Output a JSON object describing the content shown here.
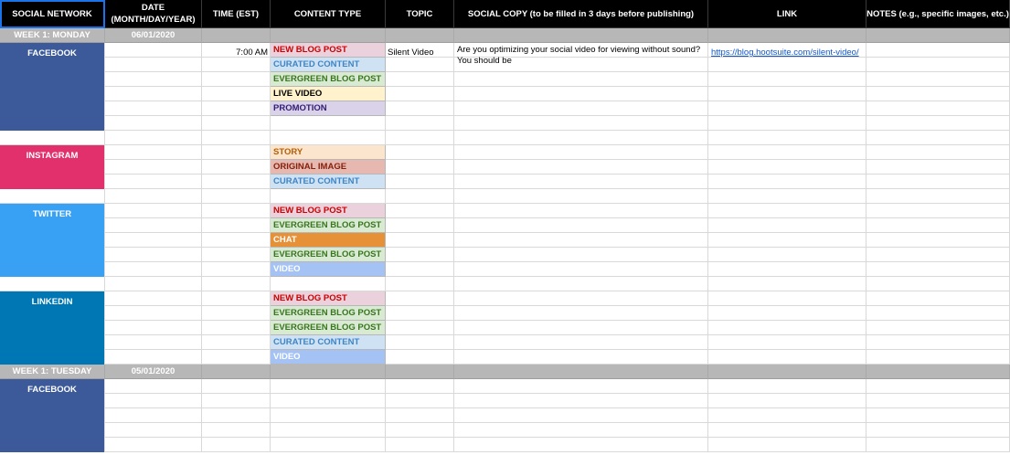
{
  "headers": [
    {
      "line1": "SOCIAL NETWORK",
      "line2": ""
    },
    {
      "line1": "DATE",
      "line2": "(MONTH/DAY/YEAR)"
    },
    {
      "line1": "TIME (EST)",
      "line2": ""
    },
    {
      "line1": "CONTENT TYPE",
      "line2": ""
    },
    {
      "line1": "TOPIC",
      "line2": ""
    },
    {
      "line1": "SOCIAL COPY (to be filled in 3 days before publishing)",
      "line2": ""
    },
    {
      "line1": "LINK",
      "line2": ""
    },
    {
      "line1": "NOTES (e.g., specific images, etc.)",
      "line2": ""
    }
  ],
  "weeks": [
    {
      "label": "WEEK 1: MONDAY",
      "date": "06/01/2020"
    },
    {
      "label": "WEEK 1: TUESDAY",
      "date": "05/01/2020"
    }
  ],
  "networks": [
    {
      "name": "FACEBOOK",
      "color": "#3c5a99"
    },
    {
      "name": "INSTAGRAM",
      "color": "#e1306c"
    },
    {
      "name": "TWITTER",
      "color": "#38a1f3"
    },
    {
      "name": "LINKEDIN",
      "color": "#0077b5"
    },
    {
      "name": "FACEBOOK",
      "color": "#3c5a99"
    }
  ],
  "content_types": [
    {
      "label": "NEW BLOG POST",
      "bg": "#ead1dc",
      "fg": "#cc0000"
    },
    {
      "label": "CURATED CONTENT",
      "bg": "#cfe2f3",
      "fg": "#3d85c6"
    },
    {
      "label": "EVERGREEN BLOG POST",
      "bg": "#d9ead3",
      "fg": "#38761d"
    },
    {
      "label": "LIVE VIDEO",
      "bg": "#fff2cc",
      "fg": "#000000"
    },
    {
      "label": "PROMOTION",
      "bg": "#d9d2e9",
      "fg": "#351c75"
    },
    {
      "label": "STORY",
      "bg": "#fce5cd",
      "fg": "#b45f06"
    },
    {
      "label": "ORIGINAL IMAGE",
      "bg": "#e6b8af",
      "fg": "#85200c"
    },
    {
      "label": "CURATED CONTENT",
      "bg": "#cfe2f3",
      "fg": "#3d85c6"
    },
    {
      "label": "NEW BLOG POST",
      "bg": "#ead1dc",
      "fg": "#cc0000"
    },
    {
      "label": "EVERGREEN BLOG POST",
      "bg": "#d9ead3",
      "fg": "#38761d"
    },
    {
      "label": "CHAT",
      "bg": "#e69138",
      "fg": "#ffffff"
    },
    {
      "label": "EVERGREEN BLOG POST",
      "bg": "#d9ead3",
      "fg": "#38761d"
    },
    {
      "label": "VIDEO",
      "bg": "#a4c2f4",
      "fg": "#ffffff"
    },
    {
      "label": "NEW BLOG POST",
      "bg": "#ead1dc",
      "fg": "#cc0000"
    },
    {
      "label": "EVERGREEN BLOG POST",
      "bg": "#d9ead3",
      "fg": "#38761d"
    },
    {
      "label": "EVERGREEN BLOG POST",
      "bg": "#d9ead3",
      "fg": "#38761d"
    },
    {
      "label": "CURATED CONTENT",
      "bg": "#cfe2f3",
      "fg": "#3d85c6"
    },
    {
      "label": "VIDEO",
      "bg": "#a4c2f4",
      "fg": "#ffffff"
    }
  ],
  "first_post": {
    "time": "7:00 AM",
    "topic": "Silent Video",
    "copy": "Are you optimizing your social video for viewing without sound? You should be",
    "link": "https://blog.hootsuite.com/silent-video/"
  }
}
